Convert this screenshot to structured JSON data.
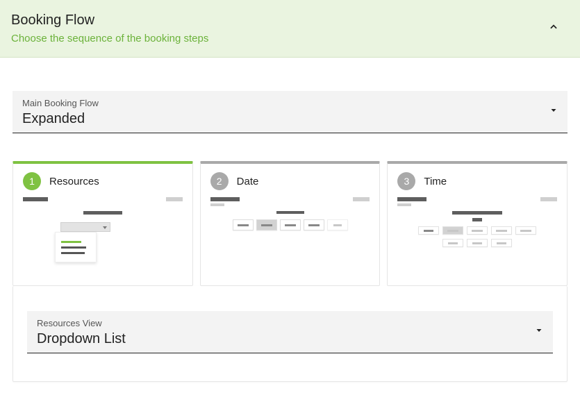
{
  "header": {
    "title": "Booking Flow",
    "subtitle": "Choose the sequence of the booking steps"
  },
  "main_select": {
    "label": "Main Booking Flow",
    "value": "Expanded"
  },
  "steps": [
    {
      "num": "1",
      "title": "Resources",
      "active": true
    },
    {
      "num": "2",
      "title": "Date",
      "active": false
    },
    {
      "num": "3",
      "title": "Time",
      "active": false
    }
  ],
  "sub_select": {
    "label": "Resources View",
    "value": "Dropdown List"
  }
}
